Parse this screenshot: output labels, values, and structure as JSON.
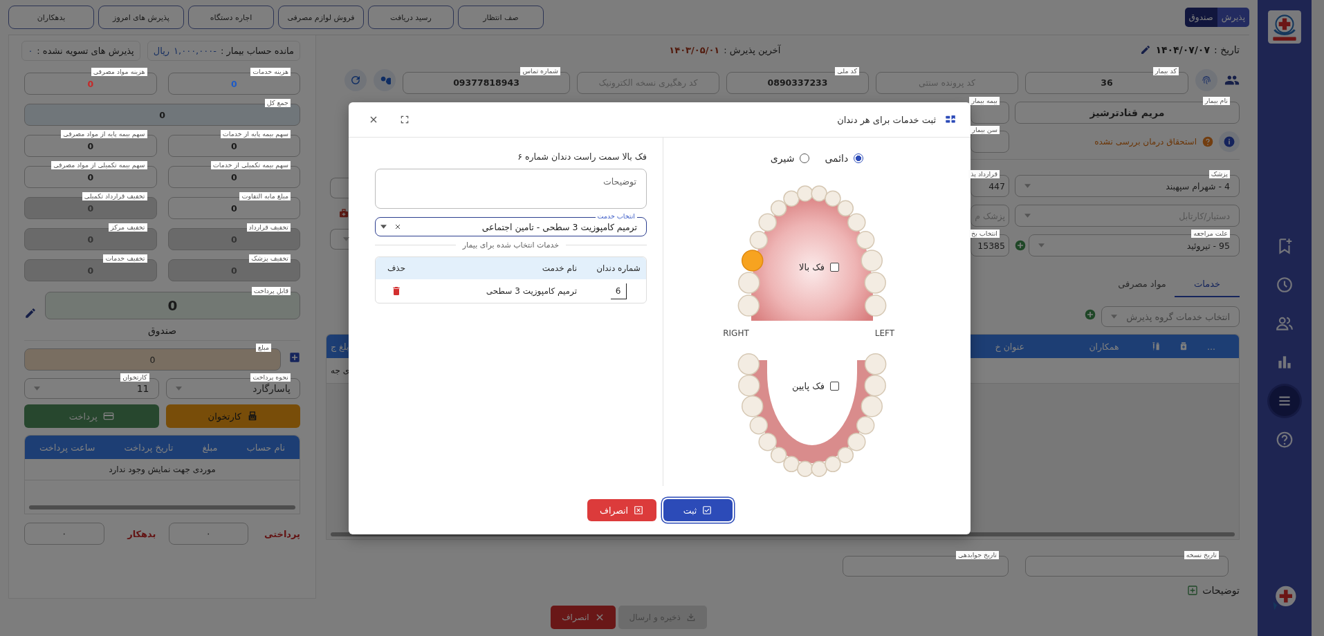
{
  "topbar": {
    "mode_switch": [
      {
        "label": "پذیرش",
        "selected": false
      },
      {
        "label": "صندوق",
        "selected": true
      }
    ],
    "buttons": [
      "صف انتظار",
      "رسید دریافت",
      "فروش لوازم مصرفی",
      "اجاره دستگاه",
      "پذیرش های امروز",
      "بدهکاران"
    ]
  },
  "header": {
    "date_label": "تاریخ :",
    "date": "۱۴۰۴/۰۷/۰۷",
    "last_admission_label": "آخرین پذیرش :",
    "last_admission": "۱۴۰۳/۰۵/۰۱"
  },
  "patient": {
    "search_fields": [
      {
        "label": "کد بیمار",
        "value": "36"
      },
      {
        "placeholder": "کد پرونده سنتی"
      },
      {
        "label": "کد ملی",
        "value": "0890337233"
      },
      {
        "placeholder": "کد رهگیری نسخه الکترونیک"
      },
      {
        "label": "شماره تماس",
        "value": "09377818943"
      }
    ],
    "name_field": {
      "label": "نام بیمار",
      "value": "مریم قنادترشیز"
    },
    "eligibility": "استحقاق درمان بررسی نشده",
    "selects": [
      {
        "label": "پزشک",
        "value": "4 - شهرام سپهبند",
        "add_button": false
      },
      {
        "placeholder": "دستیار/کارتابل",
        "add_button": false
      },
      {
        "label": "علت مراجعه",
        "value": "95 - تیروئید",
        "add_button": true
      }
    ],
    "partial_fields": [
      {
        "label": "بیمه بیمار"
      },
      {
        "label": "سن بیمار"
      },
      {
        "label": "قرارداد پذ",
        "value": "447"
      },
      {
        "placeholder": "پزشک م"
      },
      {
        "label": "انتخاب بخ",
        "value": "15385"
      }
    ]
  },
  "tabs": [
    {
      "label": "خدمات",
      "selected": true
    },
    {
      "label": "مواد مصرفی",
      "selected": false
    }
  ],
  "group_select": {
    "placeholder": "انتخاب خدمات گروه پذیرش"
  },
  "services_table": {
    "columns": [
      {
        "kind": "text",
        "label": "..."
      },
      {
        "kind": "case"
      },
      {
        "kind": "vial"
      },
      {
        "kind": "text",
        "label": "همکاران"
      },
      {
        "kind": "text",
        "label": "عنوان خ"
      }
    ],
    "cut_column": "بلغ ج",
    "cut_row_text": "ی جه"
  },
  "dates": [
    {
      "label": "تاریخ نسخه"
    },
    {
      "label": "تاریخ جوابدهی"
    }
  ],
  "notes_label": "توضیحات",
  "footer_buttons": [
    {
      "label": "ذخیره و ارسال",
      "kind": "save",
      "disabled": true
    },
    {
      "label": "انصراف",
      "kind": "cancel",
      "disabled": false
    }
  ],
  "account": {
    "balance_label": "مانده حساب بیمار :",
    "balance": "-۱,۰۰۰,۰۰۰",
    "currency": "ریال",
    "unsettled_label": "پذیرش های تسویه نشده :",
    "unsettled": "۰"
  },
  "summary_fields": [
    {
      "label": "هزینه خدمات",
      "value": "0",
      "kind": "plain",
      "disabled": false,
      "color": "#1e5bc6"
    },
    {
      "label": "هزینه مواد مصرفی",
      "value": "0",
      "kind": "plain",
      "disabled": false,
      "color": "#c62828"
    },
    {
      "label": "جمع کل",
      "value": "0",
      "kind": "total",
      "disabled": false
    },
    {
      "label": "سهم بیمه پایه از خدمات",
      "value": "0",
      "kind": "plain",
      "disabled": false
    },
    {
      "label": "سهم بیمه پایه از مواد مصرفی",
      "value": "0",
      "kind": "plain",
      "disabled": false
    },
    {
      "label": "سهم بیمه تکمیلی از خدمات",
      "value": "0",
      "kind": "plain",
      "disabled": false
    },
    {
      "label": "سهم بیمه تکمیلی از مواد مصرفی",
      "value": "0",
      "kind": "plain",
      "disabled": false
    },
    {
      "label": "مبلغ مابه التفاوت",
      "value": "0",
      "kind": "plain",
      "disabled": false
    },
    {
      "label": "تخفیف قرارداد تکمیلی",
      "value": "0",
      "kind": "plain",
      "disabled": true
    },
    {
      "label": "تخفیف قرارداد",
      "value": "0",
      "kind": "plain",
      "disabled": true
    },
    {
      "label": "تخفیف مرکز",
      "value": "0",
      "kind": "plain",
      "disabled": true
    },
    {
      "label": "تخفیف پزشک",
      "value": "0",
      "kind": "plain",
      "disabled": true
    },
    {
      "label": "تخفیف خدمات",
      "value": "0",
      "kind": "plain",
      "disabled": true
    }
  ],
  "payable": {
    "label": "قابل پرداخت",
    "value": "0"
  },
  "cashbox": {
    "title": "صندوق",
    "amount": {
      "label": "مبلغ",
      "value": "0"
    },
    "selects": [
      {
        "label": "نحوه پرداخت",
        "value": "پاسارگارد"
      },
      {
        "label": "کارتخوان",
        "value": "11"
      }
    ],
    "buttons": [
      {
        "label": "کارتخوان",
        "kind": "pos"
      },
      {
        "label": "پرداخت",
        "kind": "pay"
      }
    ],
    "table_columns": [
      "نام حساب",
      "مبلغ",
      "تاریخ پرداخت",
      "ساعت پرداخت"
    ],
    "empty_text": "موردی جهت نمایش وجود ندارد",
    "totals": [
      {
        "label": "پرداختی",
        "value": "۰"
      },
      {
        "label": "بدهکار",
        "value": "۰"
      }
    ]
  },
  "sidebar": {
    "items": [
      {
        "kind": "bookmark",
        "selected": false
      },
      {
        "kind": "clock",
        "selected": false
      },
      {
        "kind": "people",
        "selected": false
      },
      {
        "kind": "chart",
        "selected": false
      },
      {
        "kind": "menu",
        "selected": true
      },
      {
        "kind": "help",
        "selected": false
      }
    ]
  },
  "dialog": {
    "title": "ثبت خدمات برای هر دندان",
    "dentition": [
      {
        "label": "دائمی",
        "selected": true
      },
      {
        "label": "شیری",
        "selected": false
      }
    ],
    "jaws": [
      {
        "kind": "upper",
        "label": "فک بالا",
        "checked": false,
        "teeth": [
          {
            "selected": false
          },
          {
            "selected": false
          },
          {
            "selected": true
          },
          {
            "selected": false
          },
          {
            "selected": false
          },
          {
            "selected": false
          },
          {
            "selected": false
          },
          {
            "selected": false
          },
          {
            "selected": false
          },
          {
            "selected": false
          },
          {
            "selected": false
          },
          {
            "selected": false
          },
          {
            "selected": false
          },
          {
            "selected": false
          },
          {
            "selected": false
          },
          {
            "selected": false
          }
        ]
      },
      {
        "kind": "lower",
        "label": "فک پایین",
        "checked": false,
        "teeth": [
          {
            "selected": false
          },
          {
            "selected": false
          },
          {
            "selected": false
          },
          {
            "selected": false
          },
          {
            "selected": false
          },
          {
            "selected": false
          },
          {
            "selected": false
          },
          {
            "selected": false
          },
          {
            "selected": false
          },
          {
            "selected": false
          },
          {
            "selected": false
          },
          {
            "selected": false
          },
          {
            "selected": false
          },
          {
            "selected": false
          },
          {
            "selected": false
          },
          {
            "selected": false
          }
        ]
      }
    ],
    "side_labels": [
      "LEFT",
      "RIGHT"
    ],
    "tooth_caption": "فک بالا سمت راست دندان شماره ۶",
    "notes_placeholder": "توضیحات",
    "service_select": {
      "label": "انتخاب خدمت",
      "value": "ترمیم کامپوزیت 3 سطحی - تامین اجتماعی"
    },
    "selected_caption": "خدمات انتخاب شده برای بیمار",
    "table": {
      "columns": [
        "شماره دندان",
        "نام خدمت",
        "حذف"
      ],
      "rows": [
        {
          "tooth": "6",
          "service": "ترمیم کامپوزیت 3 سطحی"
        }
      ]
    },
    "buttons": [
      {
        "label": "ثبت",
        "kind": "submit"
      },
      {
        "label": "انصراف",
        "kind": "cancel"
      }
    ]
  }
}
